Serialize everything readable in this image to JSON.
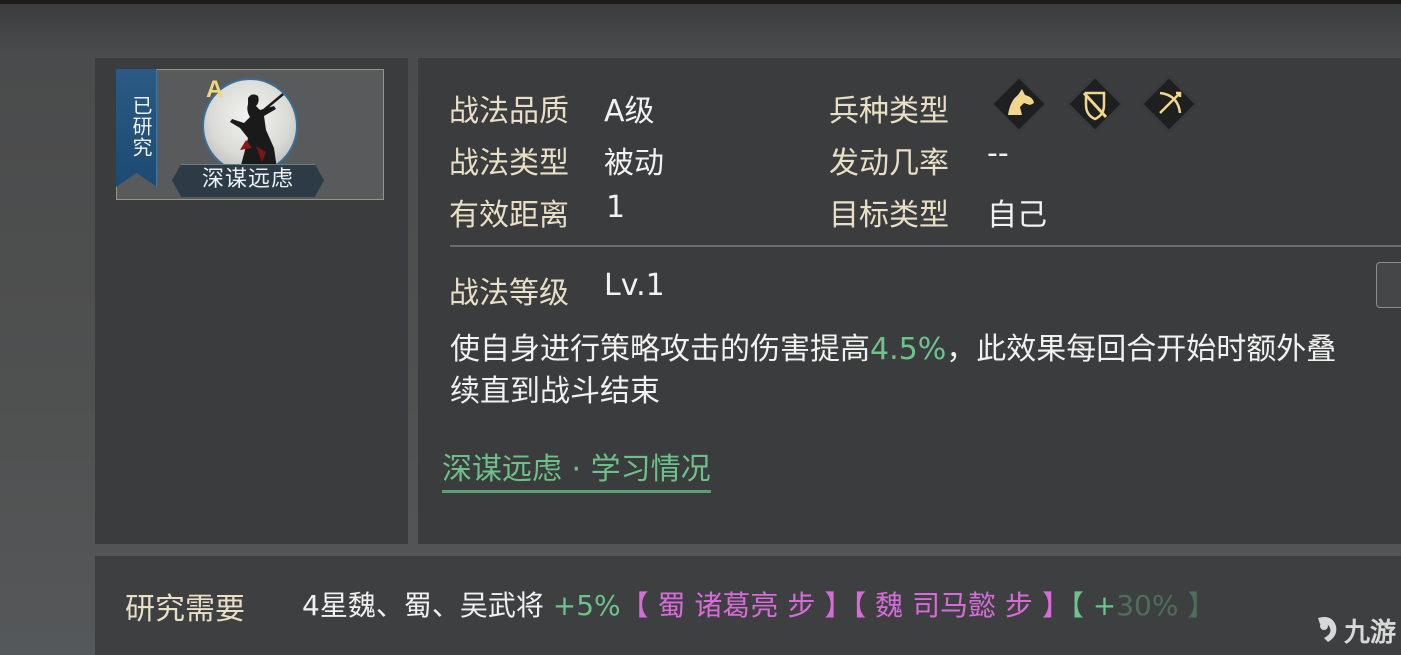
{
  "card": {
    "status": "已研究",
    "grade": "A",
    "name": "深谋远虑"
  },
  "attributes": {
    "quality_label": "战法品质",
    "quality_value": "A级",
    "type_label": "战法类型",
    "type_value": "被动",
    "range_label": "有效距离",
    "range_value": "1",
    "troop_label": "兵种类型",
    "troop_icons": [
      "cavalry-icon",
      "shield-icon",
      "bow-icon"
    ],
    "chance_label": "发动几率",
    "chance_value": "--",
    "target_label": "目标类型",
    "target_value": "自己"
  },
  "level": {
    "label": "战法等级",
    "value": "Lv.1"
  },
  "description": {
    "line1_prefix": "使自身进行策略攻击的伤害提高",
    "line1_highlight": "4.5%",
    "line1_suffix": "，此效果每回合开始时额外叠",
    "line2": "续直到战斗结束"
  },
  "link": {
    "label": "深谋远虑 · 学习情况"
  },
  "research": {
    "label": "研究需要",
    "requirement": "4星魏、蜀、吴武将",
    "bonus": "+5%",
    "hero1": "【 蜀 诸葛亮 步 】",
    "hero2": "【 魏 司马懿 步 】",
    "hero3": "【 +",
    "hero3_partial": "30% 】"
  },
  "watermark": "九游",
  "colors": {
    "label": "#e8dfc6",
    "highlight_green": "#6cc48c",
    "hero_pink": "#d76bd9",
    "ribbon_blue": "#1c4a72"
  }
}
